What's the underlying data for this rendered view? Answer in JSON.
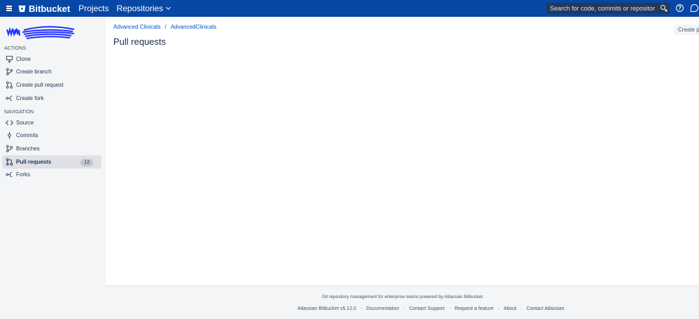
{
  "topbar": {
    "brand": "Bitbucket",
    "nav": [
      "Projects",
      "Repositories"
    ],
    "search_placeholder": "Search for code, commits or repositories...",
    "help_glyph": "?"
  },
  "sidebar": {
    "actions_label": "ACTIONS",
    "actions": [
      {
        "label": "Clone",
        "icon": "clone-icon"
      },
      {
        "label": "Create branch",
        "icon": "branch-icon"
      },
      {
        "label": "Create pull request",
        "icon": "pull-request-icon"
      },
      {
        "label": "Create fork",
        "icon": "fork-icon"
      }
    ],
    "navigation_label": "NAVIGATION",
    "navigation": [
      {
        "label": "Source",
        "icon": "code-icon"
      },
      {
        "label": "Commits",
        "icon": "commit-icon"
      },
      {
        "label": "Branches",
        "icon": "branch-icon"
      },
      {
        "label": "Pull requests",
        "icon": "pull-request-icon",
        "badge": "12",
        "active": true
      },
      {
        "label": "Forks",
        "icon": "fork-icon"
      }
    ]
  },
  "breadcrumb": {
    "project": "Advanced Clinicals",
    "separator": "/",
    "repo": "AdvancedClinicals"
  },
  "page": {
    "title": "Pull requests",
    "create_button": "Create pull request"
  },
  "footer": {
    "tagline": "Git repository management for enterprise teams powered by Atlassian Bitbucket",
    "links": [
      "Atlassian Bitbucket v5.12.0",
      "Documentation",
      "Contact Support",
      "Request a feature",
      "About",
      "Contact Atlassian"
    ]
  },
  "colors": {
    "topbar": "#0747a6",
    "sidebar": "#f4f5f7",
    "link": "#0052cc",
    "scribble": "#1f2fff"
  }
}
